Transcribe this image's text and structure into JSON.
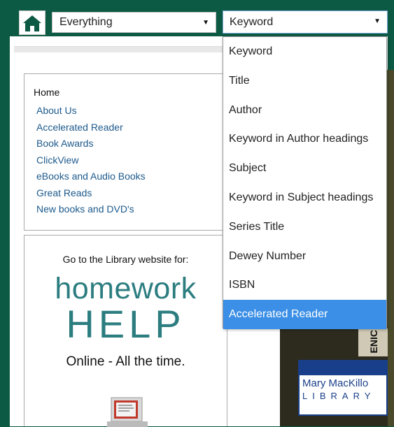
{
  "header": {
    "home_icon": "house-icon",
    "scope_select": {
      "value": "Everything",
      "arrow": "▼"
    },
    "type_select": {
      "value": "Keyword",
      "arrow": "▼"
    }
  },
  "nav": {
    "home": "Home",
    "items": [
      "About Us",
      "Accelerated Reader",
      "Book Awards",
      "ClickView",
      "eBooks and Audio Books",
      "Great Reads",
      "New books and DVD's"
    ]
  },
  "promo": {
    "caption": "Go to the Library website for:",
    "line1": "homework",
    "line2": "HELP",
    "line3": "Online - All the time.",
    "image_icon": "laptop-icon"
  },
  "photo": {
    "sign_name": "Mary MacKillo",
    "sign_library": "LIBRARY",
    "strip_text": "ENIC"
  },
  "dropdown": {
    "options": [
      "Keyword",
      "Title",
      "Author",
      "Keyword in Author headings",
      "Subject",
      "Keyword in Subject headings",
      "Series Title",
      "Dewey Number",
      "ISBN",
      "Accelerated Reader"
    ],
    "selected": "Accelerated Reader"
  },
  "colors": {
    "frame": "#0c5a43",
    "accent": "#2c7d80",
    "selected": "#3b8fe6",
    "link": "#1d5a8c"
  }
}
